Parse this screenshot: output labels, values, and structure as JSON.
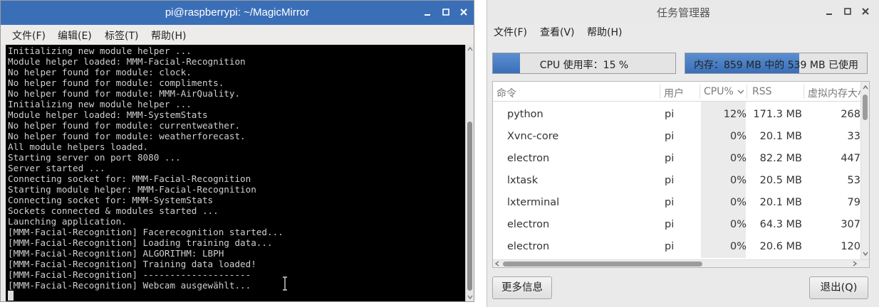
{
  "terminal": {
    "title": "pi@raspberrypi: ~/MagicMirror",
    "menu": [
      "文件(F)",
      "编辑(E)",
      "标签(T)",
      "帮助(H)"
    ],
    "output": "Initializing new module helper ...\nModule helper loaded: MMM-Facial-Recognition\nNo helper found for module: clock.\nNo helper found for module: compliments.\nNo helper found for module: MMM-AirQuality.\nInitializing new module helper ...\nModule helper loaded: MMM-SystemStats\nNo helper found for module: currentweather.\nNo helper found for module: weatherforecast.\nAll module helpers loaded.\nStarting server on port 8080 ...\nServer started ...\nConnecting socket for: MMM-Facial-Recognition\nStarting module helper: MMM-Facial-Recognition\nConnecting socket for: MMM-SystemStats\nSockets connected & modules started ...\nLaunching application.\n[MMM-Facial-Recognition] Facerecognition started...\n[MMM-Facial-Recognition] Loading training data...\n[MMM-Facial-Recognition] ALGORITHM: LBPH\n[MMM-Facial-Recognition] Training data loaded!\n[MMM-Facial-Recognition] --------------------\n[MMM-Facial-Recognition] Webcam ausgewählt..."
  },
  "task_manager": {
    "title": "任务管理器",
    "menu": [
      "文件(F)",
      "查看(V)",
      "帮助(H)"
    ],
    "cpu_meter": {
      "label": "CPU 使用率：15 %",
      "fraction": 0.15
    },
    "mem_meter": {
      "label": "内存：859 MB 中的 539 MB 已使用",
      "fraction": 0.627
    },
    "columns": [
      "命令",
      "用户",
      "CPU%",
      "RSS",
      "虚拟内存大小"
    ],
    "rows": [
      [
        "python",
        "pi",
        "12%",
        "171.3 MB",
        "268"
      ],
      [
        "Xvnc-core",
        "pi",
        "0%",
        "20.1 MB",
        "33"
      ],
      [
        "electron",
        "pi",
        "0%",
        "82.2 MB",
        "447"
      ],
      [
        "lxtask",
        "pi",
        "0%",
        "20.5 MB",
        "53"
      ],
      [
        "lxterminal",
        "pi",
        "0%",
        "20.1 MB",
        "79"
      ],
      [
        "electron",
        "pi",
        "0%",
        "64.3 MB",
        "307"
      ],
      [
        "electron",
        "pi",
        "0%",
        "20.6 MB",
        "120"
      ]
    ],
    "more_info_label": "更多信息",
    "quit_label": "退出(Q)"
  },
  "colors": {
    "terminal_title_bar": "#3a6fb8",
    "meter_fill": "#3a6fb8",
    "terminal_bg": "#000000"
  }
}
